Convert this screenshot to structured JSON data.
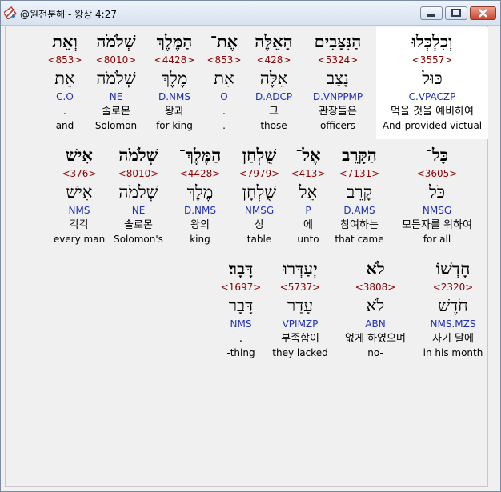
{
  "window": {
    "title": "@원전분해 - 왕상 4:27",
    "buttons": {
      "minimize": "minimize",
      "maximize": "maximize",
      "close": "close"
    }
  },
  "rows": [
    {
      "words": [
        {
          "hebrew": "וְכִלְכְּלוּ",
          "strong": "<3557>",
          "lemma": "כּוּל",
          "parsing": "C.VPACZP",
          "korean": "먹을 것을 예비하여",
          "english": "And-provided victual"
        },
        {
          "hebrew": "הַנִּצָּבִים",
          "strong": "<5324>",
          "lemma": "נָצַב",
          "parsing": "D.VNPPMP",
          "korean": "관장들은",
          "english": "officers"
        },
        {
          "hebrew": "הָאֵלֶּה",
          "strong": "<428>",
          "lemma": "אֵלֶּה",
          "parsing": "D.ADCP",
          "korean": "그",
          "english": "those"
        },
        {
          "hebrew": "אֶת־",
          "strong": "<853>",
          "lemma": "אֵת",
          "parsing": "O",
          "korean": ".",
          "english": "."
        },
        {
          "hebrew": "הַמֶּלֶךְ",
          "strong": "<4428>",
          "lemma": "מֶלֶךְ",
          "parsing": "D.NMS",
          "korean": "왕과",
          "english": "for king"
        },
        {
          "hebrew": "שְׁלֹמֹה",
          "strong": "<8010>",
          "lemma": "שְׁלֹמֹה",
          "parsing": "NE",
          "korean": "솔로몬",
          "english": "Solomon"
        },
        {
          "hebrew": "וְאֵת",
          "strong": "<853>",
          "lemma": "אֵת",
          "parsing": "C.O",
          "korean": ".",
          "english": "and"
        }
      ]
    },
    {
      "words": [
        {
          "hebrew": "כָּל־",
          "strong": "<3605>",
          "lemma": "כֹּל",
          "parsing": "NMSG",
          "korean": "모든자를 위하여",
          "english": "for all"
        },
        {
          "hebrew": "הַקָּרֵב",
          "strong": "<7131>",
          "lemma": "קָרֵב",
          "parsing": "D.AMS",
          "korean": "참여하는",
          "english": "that came"
        },
        {
          "hebrew": "אֶל־",
          "strong": "<413>",
          "lemma": "אֵל",
          "parsing": "P",
          "korean": "에",
          "english": "unto"
        },
        {
          "hebrew": "שֻׁלְחַן",
          "strong": "<7979>",
          "lemma": "שֻׁלְחָן",
          "parsing": "NMSG",
          "korean": "상",
          "english": "table"
        },
        {
          "hebrew": "הַמֶּלֶךְ־",
          "strong": "<4428>",
          "lemma": "מֶלֶךְ",
          "parsing": "D.NMS",
          "korean": "왕의",
          "english": "king"
        },
        {
          "hebrew": "שְׁלֹמֹה",
          "strong": "<8010>",
          "lemma": "שְׁלֹמֹה",
          "parsing": "NE",
          "korean": "솔로몬",
          "english": "Solomon's"
        },
        {
          "hebrew": "אִישׁ",
          "strong": "<376>",
          "lemma": "אִישׁ",
          "parsing": "NMS",
          "korean": "각각",
          "english": "every man"
        }
      ]
    },
    {
      "words": [
        {
          "hebrew": "חָדְשׁוֹ",
          "strong": "<2320>",
          "lemma": "חֹדֶשׁ",
          "parsing": "NMS.MZS",
          "korean": "자기 달에",
          "english": "in his month"
        },
        {
          "hebrew": "לֹא",
          "strong": "<3808>",
          "lemma": "לֹא",
          "parsing": "ABN",
          "korean": "없게 하였으며",
          "english": "no-"
        },
        {
          "hebrew": "יְעַדְּרוּ",
          "strong": "<5737>",
          "lemma": "עָדַר",
          "parsing": "VPIMZP",
          "korean": "부족함이",
          "english": "they lacked"
        },
        {
          "hebrew": "דָּבָר׃",
          "strong": "<1697>",
          "lemma": "דָּבָר",
          "parsing": "NMS",
          "korean": ".",
          "english": "-thing"
        }
      ]
    }
  ]
}
